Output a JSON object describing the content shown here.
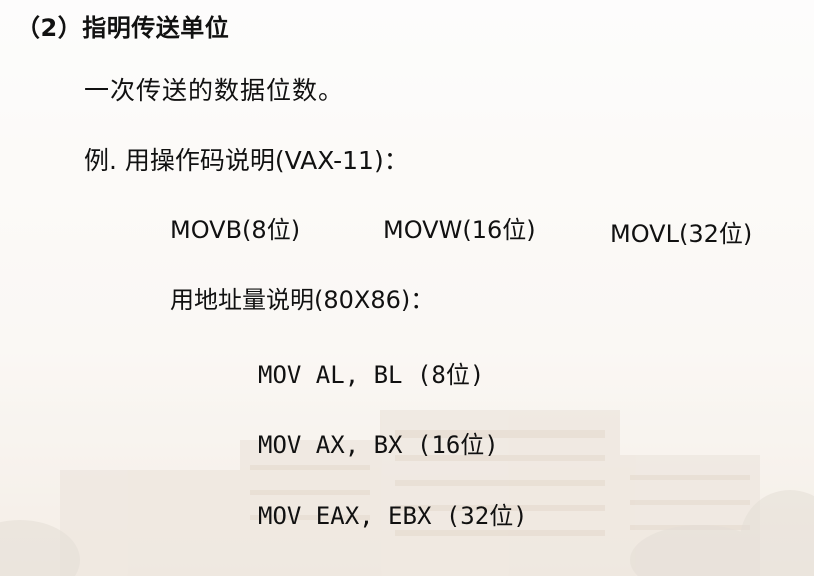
{
  "slide": {
    "heading": "（2）指明传送单位",
    "description": "一次传送的数据位数。",
    "example_intro": "例. 用操作码说明(VAX-11)：",
    "opcodes": [
      {
        "text": "MOVB(8位)"
      },
      {
        "text": "MOVW(16位)"
      },
      {
        "text": "MOVL(32位)"
      }
    ],
    "address_intro": "用地址量说明(80X86)：",
    "instructions": [
      {
        "text": "MOV AL, BL (8位)"
      },
      {
        "text": "MOV AX, BX (16位)"
      },
      {
        "text": "MOV EAX, EBX (32位)"
      }
    ]
  },
  "background": {
    "tint": "#fbf9f7",
    "building_color": "#e2d5c7",
    "tree_color": "#cfc6ba"
  }
}
